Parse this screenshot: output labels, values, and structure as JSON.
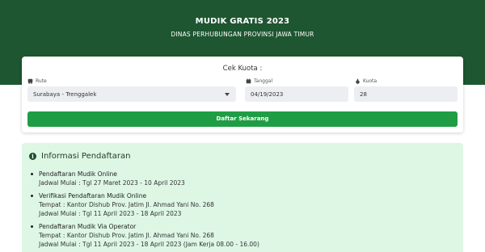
{
  "header": {
    "title": "MUDIK GRATIS 2023",
    "subtitle": "DINAS PERHUBUNGAN PROVINSI JAWA TIMUR"
  },
  "form": {
    "title": "Cek Kuota :",
    "route_label": "Rute",
    "route_value": "Surabaya - Trenggalek",
    "date_label": "Tanggal",
    "date_value": "04/19/2023",
    "quota_label": "Kuota",
    "quota_value": "28",
    "submit_label": "Daftar Sekarang",
    "icons": {
      "route": "bus-icon",
      "date": "calendar-icon",
      "quota": "bag-icon"
    }
  },
  "info": {
    "title": "Informasi Pendaftaran",
    "icon": "info-icon",
    "items": [
      {
        "title": "Pendaftaran Mudik Online",
        "lines": [
          "Jadwal Mulai : Tgl 27 Maret 2023 - 10 April 2023"
        ]
      },
      {
        "title": "Verifikasi Pendaftaran Mudik Online",
        "lines": [
          "Tempat : Kantor Dishub Prov. Jatim Jl. Ahmad Yani No. 268",
          "Jadwal Mulai : Tgl 11 April 2023 - 18 April 2023"
        ]
      },
      {
        "title": "Pendaftaran Mudik Via Operator",
        "lines": [
          "Tempat : Kantor Dishub Prov. Jatim Jl. Ahmad Yani No. 268",
          "Jadwal Mulai : Tgl 11 April 2023 - 18 April 2023 (Jam Kerja 08.00 - 16.00)"
        ]
      }
    ]
  },
  "colors": {
    "header_bg": "#1e5631",
    "button_bg": "#1f9d45",
    "info_bg": "#def7e5"
  }
}
